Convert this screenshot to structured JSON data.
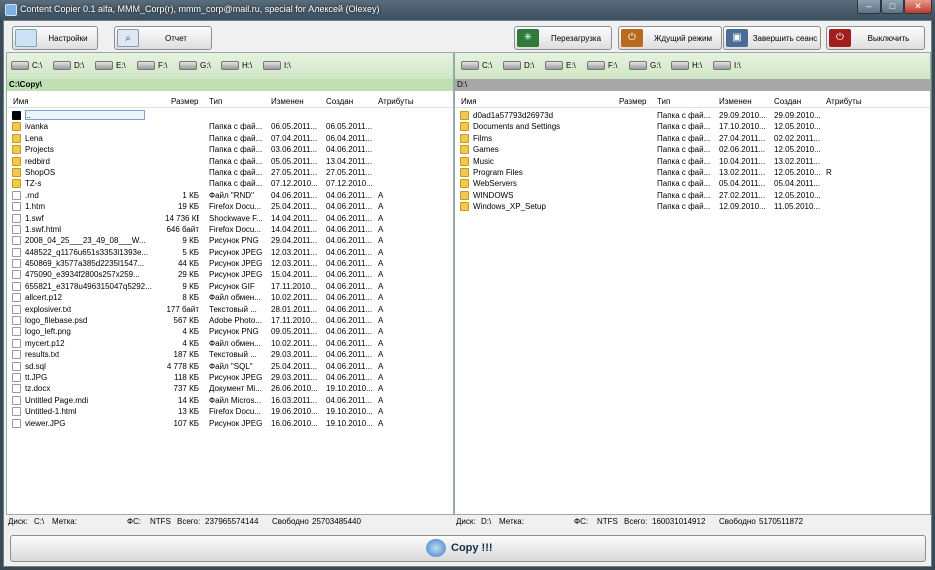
{
  "window": {
    "title": "Content Copier 0.1 alfa,   MMM_Corp(r), mmm_corp@mail.ru, special for Алексей (Olexey)",
    "min": "–",
    "max": "□",
    "close": "✕"
  },
  "toolbar": {
    "settings": "Настройки",
    "report": "Отчет",
    "restart": "Перезагрузка",
    "sleep": "Ждущий режим",
    "logoff": "Завершить сеанс",
    "shutdown": "Выключить"
  },
  "columns": {
    "name": "Имя",
    "size": "Размер",
    "type": "Тип",
    "modified": "Изменен",
    "created": "Создан",
    "attrs": "Атрибуты"
  },
  "drives": [
    "C:\\",
    "D:\\",
    "E:\\",
    "F:\\",
    "G:\\",
    "H:\\",
    "I:\\"
  ],
  "left": {
    "path": "C:\\Copy\\",
    "files": [
      {
        "name": "..",
        "size": "",
        "type": "",
        "mod": "",
        "cre": "",
        "attr": "",
        "icon": "up"
      },
      {
        "name": "ivanka",
        "size": "",
        "type": "Папка с фай...",
        "mod": "06.05.2011...",
        "cre": "06.05.2011...",
        "attr": "",
        "icon": "folder"
      },
      {
        "name": "Lena",
        "size": "",
        "type": "Папка с фай...",
        "mod": "07.04.2011...",
        "cre": "06.04.2011...",
        "attr": "",
        "icon": "folder"
      },
      {
        "name": "Projects",
        "size": "",
        "type": "Папка с фай...",
        "mod": "03.06.2011...",
        "cre": "04.06.2011...",
        "attr": "",
        "icon": "folder"
      },
      {
        "name": "redbird",
        "size": "",
        "type": "Папка с фай...",
        "mod": "05.05.2011...",
        "cre": "13.04.2011...",
        "attr": "",
        "icon": "folder"
      },
      {
        "name": "ShopOS",
        "size": "",
        "type": "Папка с фай...",
        "mod": "27.05.2011...",
        "cre": "27.05.2011...",
        "attr": "",
        "icon": "folder"
      },
      {
        "name": "TZ-s",
        "size": "",
        "type": "Папка с фай...",
        "mod": "07.12.2010...",
        "cre": "07.12.2010...",
        "attr": "",
        "icon": "folder"
      },
      {
        "name": ".rnd",
        "size": "1 КБ",
        "type": "Файл \"RND\"",
        "mod": "04.06.2011...",
        "cre": "04.06.2011...",
        "attr": "A",
        "icon": "file"
      },
      {
        "name": "1.htm",
        "size": "19 КБ",
        "type": "Firefox Docu...",
        "mod": "25.04.2011...",
        "cre": "04.06.2011...",
        "attr": "A",
        "icon": "file"
      },
      {
        "name": "1.swf",
        "size": "14 736 КБ",
        "type": "Shockwave F...",
        "mod": "14.04.2011...",
        "cre": "04.06.2011...",
        "attr": "A",
        "icon": "file"
      },
      {
        "name": "1.swf.html",
        "size": "646 байт",
        "type": "Firefox Docu...",
        "mod": "14.04.2011...",
        "cre": "04.06.2011...",
        "attr": "A",
        "icon": "file"
      },
      {
        "name": "2008_04_25___23_49_08___W...",
        "size": "9 КБ",
        "type": "Рисунок PNG",
        "mod": "29.04.2011...",
        "cre": "04.06.2011...",
        "attr": "A",
        "icon": "file"
      },
      {
        "name": "448522_q1176u651s3353l1393e...",
        "size": "5 КБ",
        "type": "Рисунок JPEG",
        "mod": "12.03.2011...",
        "cre": "04.06.2011...",
        "attr": "A",
        "icon": "file"
      },
      {
        "name": "450869_k3577a385d2235l1547...",
        "size": "44 КБ",
        "type": "Рисунок JPEG",
        "mod": "12.03.2011...",
        "cre": "04.06.2011...",
        "attr": "A",
        "icon": "file"
      },
      {
        "name": "475090_e3934f2800s257x259...",
        "size": "29 КБ",
        "type": "Рисунок JPEG",
        "mod": "15.04.2011...",
        "cre": "04.06.2011...",
        "attr": "A",
        "icon": "file"
      },
      {
        "name": "655821_e3178u496315047q5292...",
        "size": "9 КБ",
        "type": "Рисунок GIF",
        "mod": "17.11.2010...",
        "cre": "04.06.2011...",
        "attr": "A",
        "icon": "file"
      },
      {
        "name": "allcert.p12",
        "size": "8 КБ",
        "type": "Файл обмен...",
        "mod": "10.02.2011...",
        "cre": "04.06.2011...",
        "attr": "A",
        "icon": "file"
      },
      {
        "name": "explosiver.txt",
        "size": "177 байт",
        "type": "Текстовый ...",
        "mod": "28.01.2011...",
        "cre": "04.06.2011...",
        "attr": "A",
        "icon": "file"
      },
      {
        "name": "logo_filebase.psd",
        "size": "567 КБ",
        "type": "Adobe Photo...",
        "mod": "17.11.2010...",
        "cre": "04.06.2011...",
        "attr": "A",
        "icon": "file"
      },
      {
        "name": "logo_left.png",
        "size": "4 КБ",
        "type": "Рисунок PNG",
        "mod": "09.05.2011...",
        "cre": "04.06.2011...",
        "attr": "A",
        "icon": "file"
      },
      {
        "name": "mycert.p12",
        "size": "4 КБ",
        "type": "Файл обмен...",
        "mod": "10.02.2011...",
        "cre": "04.06.2011...",
        "attr": "A",
        "icon": "file"
      },
      {
        "name": "results.txt",
        "size": "187 КБ",
        "type": "Текстовый ...",
        "mod": "29.03.2011...",
        "cre": "04.06.2011...",
        "attr": "A",
        "icon": "file"
      },
      {
        "name": "sd.sql",
        "size": "4 778 КБ",
        "type": "Файл \"SQL\"",
        "mod": "25.04.2011...",
        "cre": "04.06.2011...",
        "attr": "A",
        "icon": "file"
      },
      {
        "name": "tt.JPG",
        "size": "118 КБ",
        "type": "Рисунок JPEG",
        "mod": "29.03.2011...",
        "cre": "04.06.2011...",
        "attr": "A",
        "icon": "file"
      },
      {
        "name": "tz.docx",
        "size": "737 КБ",
        "type": "Документ Mi...",
        "mod": "26.06.2010...",
        "cre": "19.10.2010...",
        "attr": "A",
        "icon": "file"
      },
      {
        "name": "Untitled Page.mdi",
        "size": "14 КБ",
        "type": "Файл Micros...",
        "mod": "16.03.2011...",
        "cre": "04.06.2011...",
        "attr": "A",
        "icon": "file"
      },
      {
        "name": "Untitled-1.html",
        "size": "13 КБ",
        "type": "Firefox Docu...",
        "mod": "19.06.2010...",
        "cre": "19.10.2010...",
        "attr": "A",
        "icon": "file"
      },
      {
        "name": "viewer.JPG",
        "size": "107 КБ",
        "type": "Рисунок JPEG",
        "mod": "16.06.2010...",
        "cre": "19.10.2010...",
        "attr": "A",
        "icon": "file"
      }
    ],
    "status": {
      "disk_label": "Диск:",
      "disk": "C:\\",
      "mark_label": "Метка:",
      "mark": "",
      "fs_label": "ФС:",
      "fs": "NTFS",
      "total_label": "Всего:",
      "total": "237965574144",
      "free_label": "Свободно",
      "free": "25703485440"
    }
  },
  "right": {
    "path": "D:\\",
    "files": [
      {
        "name": "d0ad1a57793d26973d",
        "size": "",
        "type": "Папка с фай...",
        "mod": "29.09.2010...",
        "cre": "29.09.2010...",
        "attr": "",
        "icon": "folder"
      },
      {
        "name": "Documents and Settings",
        "size": "",
        "type": "Папка с фай...",
        "mod": "17.10.2010...",
        "cre": "12.05.2010...",
        "attr": "",
        "icon": "folder"
      },
      {
        "name": "Films",
        "size": "",
        "type": "Папка с фай...",
        "mod": "27.04.2011...",
        "cre": "02.02.2011...",
        "attr": "",
        "icon": "folder"
      },
      {
        "name": "Games",
        "size": "",
        "type": "Папка с фай...",
        "mod": "02.06.2011...",
        "cre": "12.05.2010...",
        "attr": "",
        "icon": "folder"
      },
      {
        "name": "Music",
        "size": "",
        "type": "Папка с фай...",
        "mod": "10.04.2011...",
        "cre": "13.02.2011...",
        "attr": "",
        "icon": "folder"
      },
      {
        "name": "Program Files",
        "size": "",
        "type": "Папка с фай...",
        "mod": "13.02.2011...",
        "cre": "12.05.2010...",
        "attr": "R",
        "icon": "folder"
      },
      {
        "name": "WebServers",
        "size": "",
        "type": "Папка с фай...",
        "mod": "05.04.2011...",
        "cre": "05.04.2011...",
        "attr": "",
        "icon": "folder"
      },
      {
        "name": "WINDOWS",
        "size": "",
        "type": "Папка с фай...",
        "mod": "27.02.2011...",
        "cre": "12.05.2010...",
        "attr": "",
        "icon": "folder"
      },
      {
        "name": "Windows_XP_Setup",
        "size": "",
        "type": "Папка с фай...",
        "mod": "12.09.2010...",
        "cre": "11.05.2010...",
        "attr": "",
        "icon": "folder"
      }
    ],
    "status": {
      "disk_label": "Диск:",
      "disk": "D:\\",
      "mark_label": "Метка:",
      "mark": "",
      "fs_label": "ФС:",
      "fs": "NTFS",
      "total_label": "Всего:",
      "total": "160031014912",
      "free_label": "Свободно",
      "free": "5170511872"
    }
  },
  "copy_label": "Copy !!!"
}
